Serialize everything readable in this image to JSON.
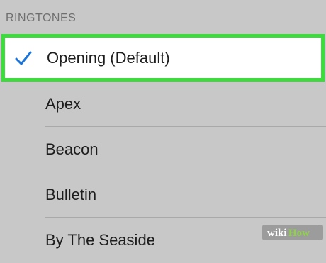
{
  "section": {
    "header": "RINGTONES"
  },
  "ringtones": [
    {
      "label": "Opening (Default)",
      "selected": true
    },
    {
      "label": "Apex",
      "selected": false
    },
    {
      "label": "Beacon",
      "selected": false
    },
    {
      "label": "Bulletin",
      "selected": false
    },
    {
      "label": "By The Seaside",
      "selected": false
    }
  ],
  "watermark": {
    "text": "wikiHow"
  },
  "colors": {
    "background": "#c8c8c8",
    "selected_row": "#ffffff",
    "highlight_border": "#3ddc3d",
    "checkmark": "#1a73d9",
    "separator": "#a9a9a9"
  }
}
